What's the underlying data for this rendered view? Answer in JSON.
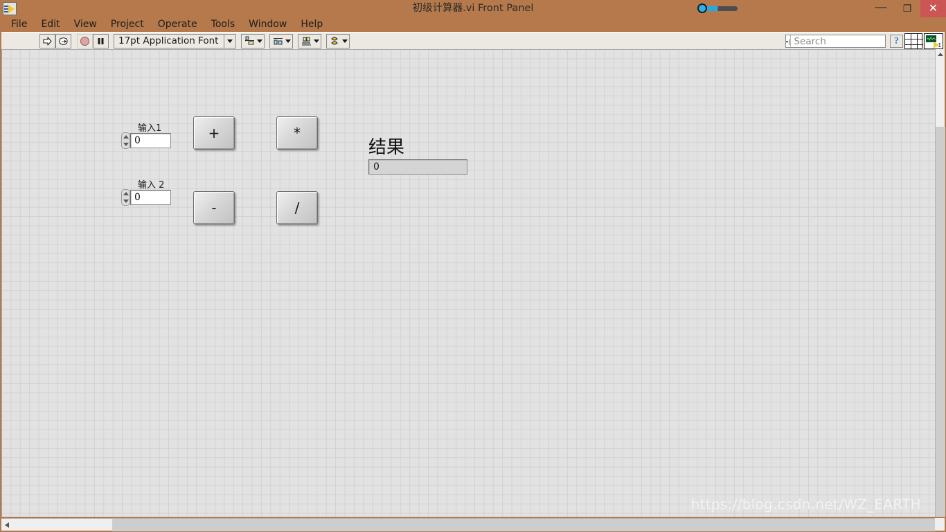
{
  "window": {
    "title": "初级计算器.vi Front Panel",
    "app_icon": "labview-vi-icon",
    "minimize_label": "—",
    "maximize_label": "❐",
    "close_label": "✕",
    "title_accent_color": "#b5794b",
    "close_button_color": "#cc5656"
  },
  "menubar": {
    "items": [
      {
        "label": "File"
      },
      {
        "label": "Edit"
      },
      {
        "label": "View"
      },
      {
        "label": "Project"
      },
      {
        "label": "Operate"
      },
      {
        "label": "Tools"
      },
      {
        "label": "Window"
      },
      {
        "label": "Help"
      }
    ]
  },
  "toolbar": {
    "run_icon": "run-arrow-icon",
    "run_continuously_icon": "run-continuously-icon",
    "abort_icon": "abort-execution-icon",
    "pause_icon": "pause-icon",
    "font_selector": {
      "value": "17pt Application Font"
    },
    "align_objects_icon": "align-objects-icon",
    "distribute_objects_icon": "distribute-objects-icon",
    "resize_objects_icon": "resize-objects-icon",
    "reorder_icon": "reorder-objects-icon",
    "search": {
      "placeholder": "Search",
      "value": "",
      "icon": "magnifier-icon"
    },
    "help_label": "?",
    "grid_icon": "context-help-grid-icon",
    "vi_icon": "vi-connector-icon",
    "vi_icon_number": "1"
  },
  "panel": {
    "background_color": "#e2e2e2",
    "grid_line_color": "#d2d2d2",
    "controls": [
      {
        "name": "input-1",
        "label": "输入1",
        "value": "0",
        "type": "numeric-control"
      },
      {
        "name": "input-2",
        "label": "输入 2",
        "value": "0",
        "type": "numeric-control"
      }
    ],
    "buttons": [
      {
        "name": "add-button",
        "label": "+"
      },
      {
        "name": "multiply-button",
        "label": "*"
      },
      {
        "name": "subtract-button",
        "label": "-"
      },
      {
        "name": "divide-button",
        "label": "/"
      }
    ],
    "result": {
      "label": "结果",
      "value": "0",
      "type": "numeric-indicator"
    },
    "watermark": "https://blog.csdn.net/WZ_EARTH"
  }
}
